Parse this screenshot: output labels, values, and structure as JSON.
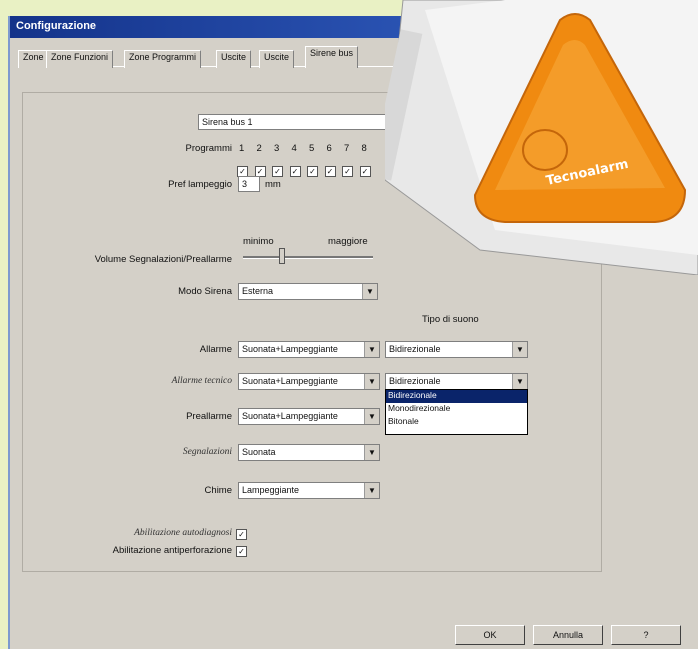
{
  "window": {
    "title": "Configurazione"
  },
  "tabs": [
    {
      "label": "Zone"
    },
    {
      "label": "Zone Funzioni"
    },
    {
      "label": "Zone Programmi"
    },
    {
      "label": "Uscite"
    },
    {
      "label": "Uscite"
    },
    {
      "label": "Sirene bus"
    }
  ],
  "siren": {
    "name_value": "Sirena bus 1",
    "programs_label": "Programmi",
    "program_numbers": [
      "1",
      "2",
      "3",
      "4",
      "5",
      "6",
      "7",
      "8"
    ],
    "flash_time_label": "Pref lampeggio",
    "flash_time_value": "3",
    "flash_time_unit": "mm",
    "slider_min_label": "minimo",
    "slider_max_label": "maggiore",
    "slider_level_fraction": 0.3,
    "volume_label": "Volume Segnalazioni/Preallarme",
    "mode_label": "Modo Sirena",
    "mode_value": "Esterna",
    "sound_type_header": "Tipo di suono",
    "rows": [
      {
        "label": "Allarme",
        "value": "Suonata+Lampeggiante",
        "sound": "Bidirezionale"
      },
      {
        "label": "Allarme tecnico",
        "value": "Suonata+Lampeggiante",
        "sound": "Bidirezionale"
      },
      {
        "label": "Preallarme",
        "value": "Suonata+Lampeggiante"
      },
      {
        "label": "Segnalazioni",
        "value": "Suonata"
      },
      {
        "label": "Chime",
        "value": "Lampeggiante"
      }
    ],
    "sound_options": [
      "Bidirezionale",
      "Monodirezionale",
      "Bitonale"
    ],
    "enable_autodiag_label": "Abilitazione autodiagnosi",
    "enable_antitamper_label": "Abilitazione antiperforazione"
  },
  "buttons": {
    "ok": "OK",
    "cancel": "Annulla",
    "help": "?"
  },
  "photo": {
    "brand_text": "Tecnoalarm",
    "accent": "#f08a10"
  }
}
